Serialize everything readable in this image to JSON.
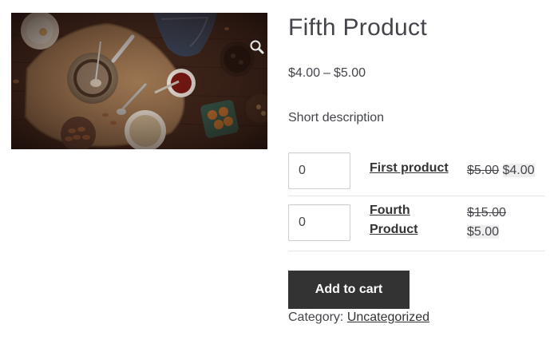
{
  "product": {
    "title": "Fifth Product",
    "price_min": "$4.00",
    "price_sep": "–",
    "price_max": "$5.00",
    "short_description": "Short description"
  },
  "grouped_items": [
    {
      "name": "First product",
      "qty": "0",
      "regular_price": "$5.00",
      "sale_price": "$4.00"
    },
    {
      "name": "Fourth Product",
      "qty": "0",
      "regular_price": "$15.00",
      "sale_price": "$5.00"
    }
  ],
  "add_to_cart_label": "Add to cart",
  "category": {
    "label": "Category:",
    "value": "Uncategorized"
  },
  "icons": {
    "zoom": "zoom-icon"
  },
  "colors": {
    "button_bg": "#333333",
    "text": "#43454b",
    "sale_highlight": "#eeeeee"
  }
}
